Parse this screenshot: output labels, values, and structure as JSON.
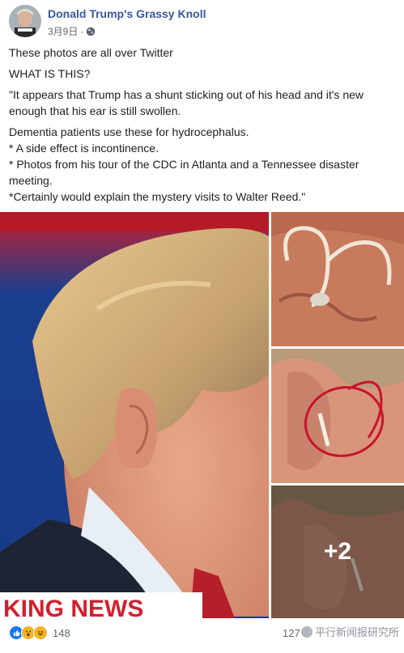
{
  "post": {
    "page_name": "Donald Trump's Grassy Knoll",
    "timestamp": "3月9日",
    "privacy_icon": "globe-icon",
    "text": {
      "line1": "These photos are all over Twitter",
      "line2": "WHAT IS THIS?",
      "line3": "\"It appears that Trump has a shunt sticking out of his head and it's new enough that his ear is still swollen.",
      "line4": "Dementia patients use these for hydrocephalus.",
      "line5": "* A side effect is incontinence.",
      "line6": "* Photos from his tour of the CDC in Atlanta and a Tennessee disaster meeting.",
      "line7": "*Certainly would explain the mystery visits to Walter Reed.\""
    },
    "photos": {
      "main_banner": "KING NEWS",
      "more_count": "+2"
    },
    "footer": {
      "reaction_icons": [
        "like-icon",
        "wow-icon",
        "haha-icon"
      ],
      "reaction_count": "148",
      "comments_count": "127",
      "watermark": "平行新闻报研究所"
    }
  },
  "colors": {
    "page_name": "#385898",
    "meta": "#606770",
    "like": "#1877f2",
    "emoji": "#f7b125"
  }
}
